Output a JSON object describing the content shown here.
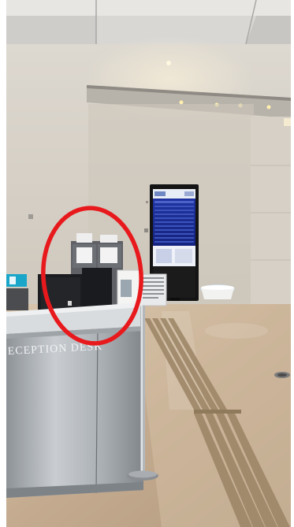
{
  "scene": {
    "desk_sign": "ECEPTION DESK",
    "highlight_color": "#e8191c",
    "signage": {
      "title": "",
      "lines": [
        "",
        "",
        "",
        "",
        ""
      ]
    }
  },
  "colors": {
    "wall": "#d9d4cc",
    "floor": "#c9b49a",
    "ceiling": "#e7e5e2",
    "steel": "#b8bcc0",
    "screen": "#1a2e8c"
  }
}
